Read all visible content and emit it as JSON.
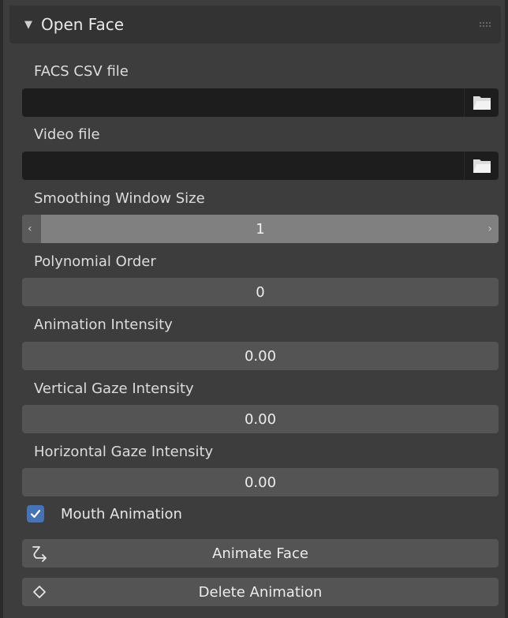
{
  "panel": {
    "title": "Open Face",
    "icons": {
      "collapse": "triangle-down-icon",
      "grip": "drag-grip-icon"
    }
  },
  "fields": {
    "facs_csv": {
      "label": "FACS CSV file",
      "value": "",
      "icon": "folder-icon"
    },
    "video": {
      "label": "Video file",
      "value": "",
      "icon": "folder-icon"
    },
    "smoothing": {
      "label": "Smoothing Window Size",
      "value": "1",
      "left_arrow": "‹",
      "right_arrow": "›"
    },
    "polynomial": {
      "label": "Polynomial Order",
      "value": "0"
    },
    "animation_intensity": {
      "label": "Animation Intensity",
      "value": "0.00"
    },
    "vertical_gaze": {
      "label": "Vertical Gaze Intensity",
      "value": "0.00"
    },
    "horizontal_gaze": {
      "label": "Horizontal Gaze Intensity",
      "value": "0.00"
    }
  },
  "mouth_animation": {
    "label": "Mouth Animation",
    "checked": true
  },
  "buttons": {
    "animate": {
      "label": "Animate Face",
      "icon": "animate-arrow-icon"
    },
    "delete": {
      "label": "Delete Animation",
      "icon": "keyframe-diamond-icon"
    }
  },
  "colors": {
    "accent": "#4772b3",
    "panel_bg": "#3d3d3d",
    "field_bg": "#545454",
    "file_bg": "#1d1d1d",
    "slider_bg": "#808080"
  }
}
